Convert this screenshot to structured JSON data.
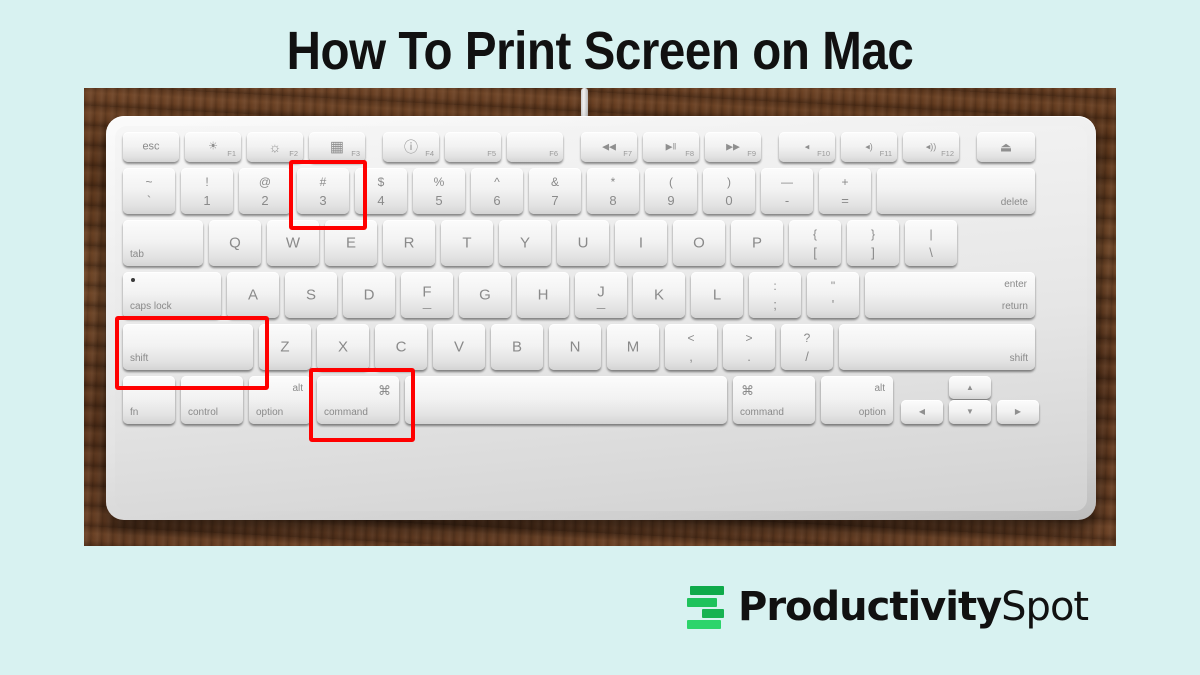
{
  "page": {
    "background_color": "#d8f2f1",
    "title": "How To Print Screen on Mac"
  },
  "photo": {
    "alt_subject": "Apple wireless keyboard on a wooden desk",
    "surface": "wood-desk",
    "cable": "usb-cable"
  },
  "annotations": [
    {
      "name": "highlight-key-3",
      "target": "3"
    },
    {
      "name": "highlight-key-shift",
      "target": "shift"
    },
    {
      "name": "highlight-key-command",
      "target": "command"
    }
  ],
  "keyboard": {
    "function_row": [
      {
        "label": "esc",
        "fn": ""
      },
      {
        "glyph": "☀",
        "fn": "F1"
      },
      {
        "glyph": "☼",
        "fn": "F2"
      },
      {
        "glyph": "▦",
        "fn": "F3"
      },
      {
        "glyph": "ⓘ",
        "fn": "F4"
      },
      {
        "glyph": "",
        "fn": "F5"
      },
      {
        "glyph": "",
        "fn": "F6"
      },
      {
        "glyph": "◀◀",
        "fn": "F7"
      },
      {
        "glyph": "▶‖",
        "fn": "F8"
      },
      {
        "glyph": "▶▶",
        "fn": "F9"
      },
      {
        "glyph": "◂",
        "fn": "F10"
      },
      {
        "glyph": "◂)",
        "fn": "F11"
      },
      {
        "glyph": "◂))",
        "fn": "F12"
      },
      {
        "glyph": "⏏",
        "fn": ""
      }
    ],
    "number_row": [
      {
        "top": "~",
        "bottom": "`"
      },
      {
        "top": "!",
        "bottom": "1"
      },
      {
        "top": "@",
        "bottom": "2"
      },
      {
        "top": "#",
        "bottom": "3"
      },
      {
        "top": "$",
        "bottom": "4"
      },
      {
        "top": "%",
        "bottom": "5"
      },
      {
        "top": "^",
        "bottom": "6"
      },
      {
        "top": "&",
        "bottom": "7"
      },
      {
        "top": "*",
        "bottom": "8"
      },
      {
        "top": "(",
        "bottom": "9"
      },
      {
        "top": ")",
        "bottom": "0"
      },
      {
        "top": "—",
        "bottom": "-"
      },
      {
        "top": "+",
        "bottom": "="
      },
      {
        "label": "delete"
      }
    ],
    "qwerty_row": [
      {
        "label": "tab"
      },
      {
        "label": "Q"
      },
      {
        "label": "W"
      },
      {
        "label": "E"
      },
      {
        "label": "R"
      },
      {
        "label": "T"
      },
      {
        "label": "Y"
      },
      {
        "label": "U"
      },
      {
        "label": "I"
      },
      {
        "label": "O"
      },
      {
        "label": "P"
      },
      {
        "top": "{",
        "bottom": "["
      },
      {
        "top": "}",
        "bottom": "]"
      },
      {
        "top": "|",
        "bottom": "\\"
      }
    ],
    "home_row": [
      {
        "label": "caps lock"
      },
      {
        "label": "A"
      },
      {
        "label": "S"
      },
      {
        "label": "D"
      },
      {
        "label": "F"
      },
      {
        "label": "G"
      },
      {
        "label": "H"
      },
      {
        "label": "J"
      },
      {
        "label": "K"
      },
      {
        "label": "L"
      },
      {
        "top": ":",
        "bottom": ";"
      },
      {
        "top": "\"",
        "bottom": "'"
      },
      {
        "label": "return",
        "label2": "enter"
      }
    ],
    "shift_row": [
      {
        "label": "shift"
      },
      {
        "label": "Z"
      },
      {
        "label": "X"
      },
      {
        "label": "C"
      },
      {
        "label": "V"
      },
      {
        "label": "B"
      },
      {
        "label": "N"
      },
      {
        "label": "M"
      },
      {
        "top": "<",
        "bottom": ","
      },
      {
        "top": ">",
        "bottom": "."
      },
      {
        "top": "?",
        "bottom": "/"
      },
      {
        "label": "shift"
      }
    ],
    "bottom_row": [
      {
        "label": "fn"
      },
      {
        "label": "control"
      },
      {
        "label": "option",
        "top": "alt"
      },
      {
        "label": "command",
        "top": "⌘"
      },
      {
        "label": ""
      },
      {
        "label": "command",
        "top": "⌘"
      },
      {
        "label": "option",
        "top": "alt"
      }
    ],
    "arrow_keys": [
      {
        "glyph": "◀",
        "name": "arrow-left"
      },
      {
        "glyph": "▲",
        "name": "arrow-up"
      },
      {
        "glyph": "▼",
        "name": "arrow-down"
      },
      {
        "glyph": "▶",
        "name": "arrow-right"
      }
    ]
  },
  "logo": {
    "brand_bold": "Productivity",
    "brand_light": "Spot",
    "mark_colors": [
      "#0eaa4a",
      "#1fc25c",
      "#17b352",
      "#2dd46b"
    ]
  }
}
